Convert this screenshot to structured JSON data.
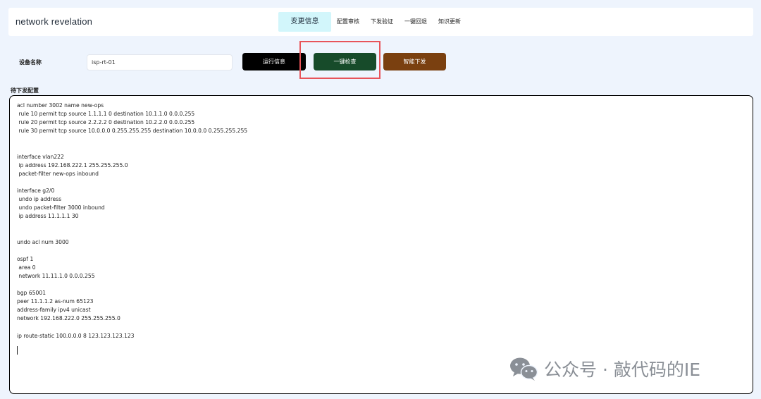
{
  "header": {
    "brand": "network revelation",
    "nav": [
      {
        "label": "变更信息",
        "active": true
      },
      {
        "label": "配置审核"
      },
      {
        "label": "下发验证"
      },
      {
        "label": "一键回退"
      },
      {
        "label": "知识更新"
      }
    ]
  },
  "form": {
    "device_label": "设备名称",
    "device_value": "isp-rt-01"
  },
  "buttons": {
    "run_info": "运行信息",
    "one_click_check": "一键检查",
    "smart_deploy": "智能下发"
  },
  "pending": {
    "label": "待下发配置",
    "config": "acl number 3002 name new-ops\n rule 10 permit tcp source 1.1.1.1 0 destination 10.1.1.0 0.0.0.255\n rule 20 permit tcp source 2.2.2.2 0 destination 10.2.2.0 0.0.0.255\n rule 30 permit tcp source 10.0.0.0 0.255.255.255 destination 10.0.0.0 0.255.255.255\n\n\ninterface vlan222\n ip address 192.168.222.1 255.255.255.0\n packet-filter new-ops inbound\n\ninterface g2/0\n undo ip address\n undo packet-filter 3000 inbound\n ip address 11.1.1.1 30\n\n\nundo acl num 3000\n\nospf 1\n area 0\n network 11.11.1.0 0.0.0.255\n\nbgp 65001\npeer 11.1.1.2 as-num 65123\naddress-family ipv4 unicast\nnetwork 192.168.222.0 255.255.255.0\n\nip route-static 100.0.0.0 8 123.123.123.123"
  },
  "watermark": {
    "text": "公众号 · 敲代码的IE",
    "icon": "wechat-icon"
  },
  "colors": {
    "page_bg": "#eef4fd",
    "active_tab": "#d2f6fb",
    "run_button": "#000000",
    "check_button": "#174b2a",
    "deploy_button": "#7a4010",
    "highlight_box": "#e8545a"
  }
}
